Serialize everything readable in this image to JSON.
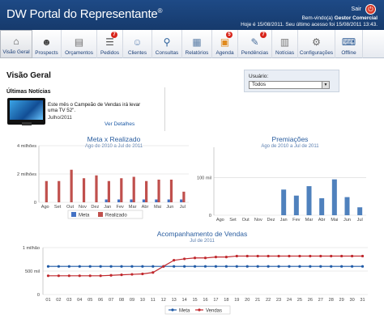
{
  "app": {
    "title": "DW Portal do Representante",
    "title_mark": "®",
    "logout_label": "Sair",
    "welcome_prefix": "Bem-vindo(a)",
    "welcome_user": "Gestor Comercial",
    "last_access": "Hoje é 15/08/2011. Seu último acesso foi 15/08/2011 13:43."
  },
  "toolbar": {
    "items": [
      {
        "label": "Visão Geral",
        "icon": "home-icon",
        "badge": ""
      },
      {
        "label": "Prospects",
        "icon": "prospects-icon",
        "badge": ""
      },
      {
        "label": "Orçamentos",
        "icon": "budget-icon",
        "badge": ""
      },
      {
        "label": "Pedidos",
        "icon": "orders-icon",
        "badge": "7"
      },
      {
        "label": "Clientes",
        "icon": "clients-icon",
        "badge": ""
      },
      {
        "label": "Consultas",
        "icon": "search-icon",
        "badge": ""
      },
      {
        "label": "Relatórios",
        "icon": "reports-icon",
        "badge": ""
      },
      {
        "label": "Agenda",
        "icon": "calendar-icon",
        "badge": "5"
      },
      {
        "label": "Pendências",
        "icon": "pending-icon",
        "badge": "7"
      },
      {
        "label": "Notícias",
        "icon": "news-icon",
        "badge": ""
      },
      {
        "label": "Configurações",
        "icon": "settings-icon",
        "badge": ""
      },
      {
        "label": "Offline",
        "icon": "offline-icon",
        "badge": ""
      }
    ]
  },
  "main": {
    "page_title": "Visão Geral",
    "user_label": "Usuário:",
    "user_selected": "Todos",
    "news": {
      "section_title": "Últimas Notícias",
      "headline": "Este mês o Campeão de Vendas irá levar uma TV 52\".",
      "date": "Julho/2011",
      "more_link": "Ver Detalhes"
    }
  },
  "chart_data": [
    {
      "type": "bar",
      "title": "Meta x Realizado",
      "subtitle": "Ago de 2010 a Jul de 2011",
      "categories": [
        "Ago",
        "Set",
        "Out",
        "Nov",
        "Dez",
        "Jan",
        "Fev",
        "Mar",
        "Abr",
        "Mai",
        "Jun",
        "Jul"
      ],
      "y_tick_labels": [
        "0",
        "2 milhões",
        "4 milhões"
      ],
      "ylim": [
        0,
        4000000
      ],
      "series": [
        {
          "name": "Meta",
          "color": "#4472c4",
          "values": [
            0,
            0,
            0,
            0,
            0,
            200000,
            200000,
            200000,
            200000,
            200000,
            200000,
            200000
          ]
        },
        {
          "name": "Realizado",
          "color": "#c0504d",
          "values": [
            1500000,
            1500000,
            2300000,
            1700000,
            1900000,
            1500000,
            1700000,
            1800000,
            1500000,
            1600000,
            1600000,
            750000
          ]
        }
      ],
      "legend": "bottom"
    },
    {
      "type": "bar",
      "title": "Premiações",
      "subtitle": "Ago de 2010 a Jul de 2011",
      "categories": [
        "Ago",
        "Set",
        "Out",
        "Nov",
        "Dez",
        "Jan",
        "Fev",
        "Mar",
        "Abr",
        "Mai",
        "Jun",
        "Jul"
      ],
      "y_tick_labels": [
        "0",
        "100 mil"
      ],
      "ylim": [
        0,
        180000
      ],
      "series": [
        {
          "name": "Premiações",
          "color": "#4f81bd",
          "values": [
            0,
            0,
            0,
            0,
            0,
            68000,
            52000,
            77000,
            45000,
            95000,
            48000,
            21000
          ]
        }
      ]
    },
    {
      "type": "line",
      "title": "Acompanhamento de Vendas",
      "subtitle": "Jul de 2011",
      "categories": [
        "01",
        "02",
        "03",
        "04",
        "05",
        "06",
        "07",
        "08",
        "09",
        "10",
        "11",
        "12",
        "13",
        "14",
        "15",
        "16",
        "17",
        "18",
        "19",
        "20",
        "21",
        "22",
        "23",
        "24",
        "25",
        "26",
        "27",
        "28",
        "29",
        "30",
        "31"
      ],
      "y_tick_labels": [
        "0",
        "500 mil",
        "1 milhão"
      ],
      "ylim": [
        0,
        1000000
      ],
      "series": [
        {
          "name": "Meta",
          "color": "#1f5aa6",
          "values": [
            600000,
            600000,
            600000,
            600000,
            600000,
            600000,
            600000,
            600000,
            600000,
            600000,
            600000,
            600000,
            600000,
            600000,
            600000,
            600000,
            600000,
            600000,
            600000,
            600000,
            600000,
            600000,
            600000,
            600000,
            600000,
            600000,
            600000,
            600000,
            600000,
            600000,
            600000
          ]
        },
        {
          "name": "Vendas",
          "color": "#c0282d",
          "values": [
            400000,
            400000,
            400000,
            400000,
            400000,
            400000,
            410000,
            420000,
            430000,
            440000,
            470000,
            600000,
            730000,
            760000,
            780000,
            780000,
            800000,
            800000,
            820000,
            820000,
            820000,
            820000,
            820000,
            820000,
            820000,
            820000,
            820000,
            820000,
            820000,
            820000,
            820000
          ]
        }
      ],
      "legend": "bottom"
    }
  ]
}
